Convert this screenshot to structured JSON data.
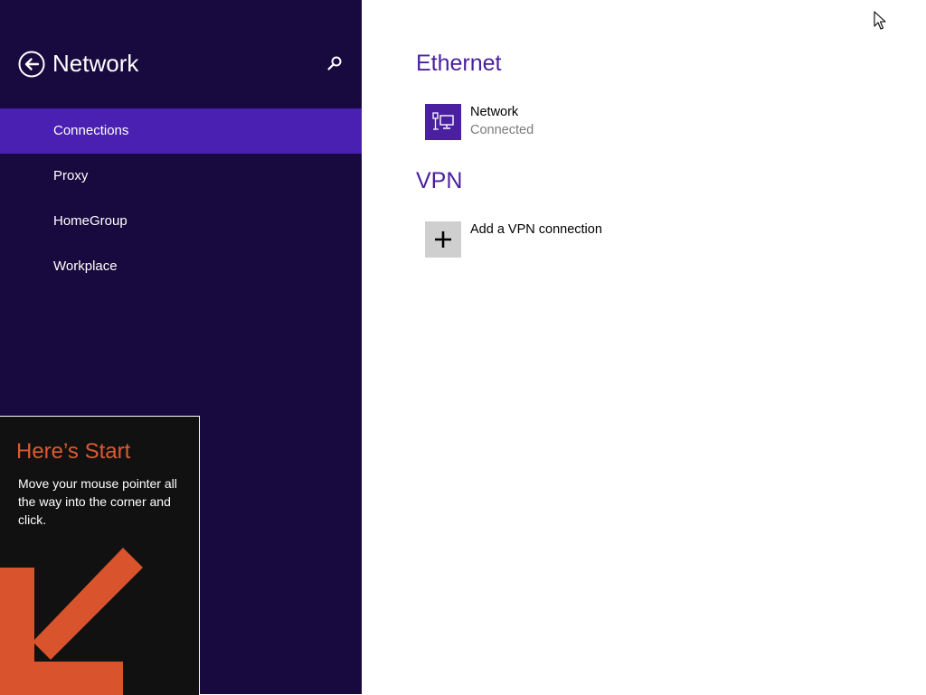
{
  "sidebar": {
    "title": "Network",
    "back_icon": "back-arrow-icon",
    "search_icon": "search-icon",
    "nav_items": [
      {
        "label": "Connections",
        "active": true
      },
      {
        "label": "Proxy",
        "active": false
      },
      {
        "label": "HomeGroup",
        "active": false
      },
      {
        "label": "Workplace",
        "active": false
      }
    ]
  },
  "tip": {
    "title": "Here’s Start",
    "body": "Move your mouse pointer all the way into the corner and click.",
    "icon": "down-left-arrow-icon"
  },
  "main": {
    "ethernet": {
      "heading": "Ethernet",
      "connection": {
        "name": "Network",
        "status": "Connected",
        "icon": "ethernet-network-icon"
      }
    },
    "vpn": {
      "heading": "VPN",
      "add_label": "Add a VPN connection",
      "icon": "plus-icon"
    }
  },
  "colors": {
    "sidebar_bg": "#180a3e",
    "active_item_bg": "#4920b2",
    "accent": "#4a1fa0",
    "tip_title": "#dd5a32",
    "tip_arrow": "#d9532c"
  },
  "cursor_icon": "mouse-pointer-icon"
}
